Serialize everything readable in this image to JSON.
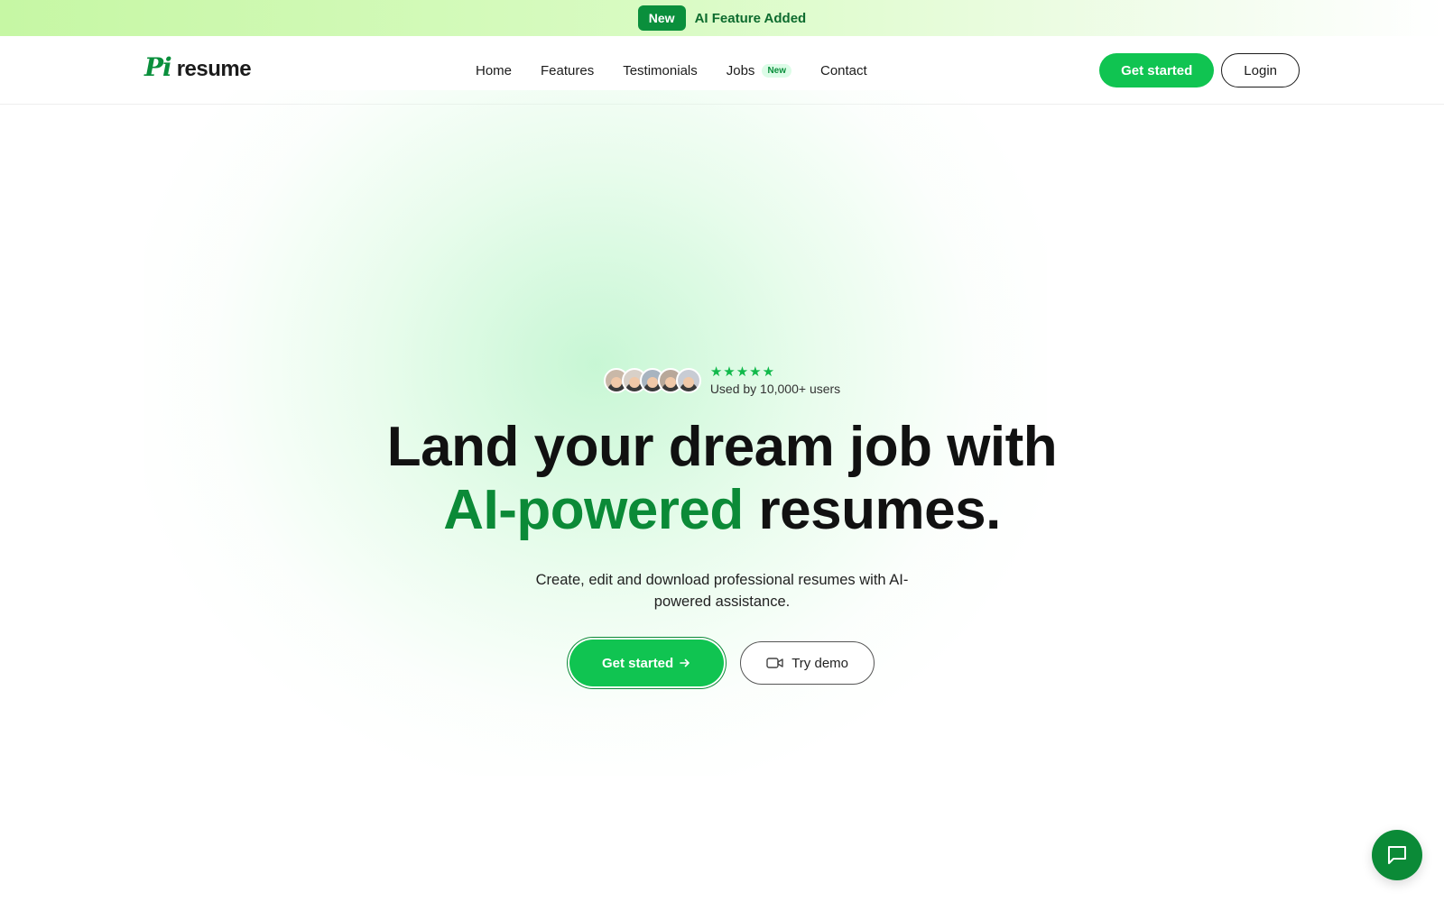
{
  "announcement": {
    "badge": "New",
    "message": "AI Feature Added"
  },
  "brand": {
    "mark": "Pi",
    "name": "resume",
    "accent_color": "#0b8a37",
    "button_color": "#10c451"
  },
  "nav": {
    "items": [
      {
        "label": "Home"
      },
      {
        "label": "Features"
      },
      {
        "label": "Testimonials"
      },
      {
        "label": "Jobs",
        "badge": "New"
      },
      {
        "label": "Contact"
      }
    ],
    "primary_button": "Get started",
    "login_button": "Login"
  },
  "hero": {
    "rating_stars": 5,
    "stars": "★★★★★",
    "users_text": "Used by 10,000+ users",
    "headline_line1": "Land your dream job with",
    "headline_accent": "AI-powered",
    "headline_rest": "resumes.",
    "subtitle": "Create, edit and download professional resumes with AI-powered assistance.",
    "cta_primary": "Get started",
    "cta_primary_icon": "arrow-right-icon",
    "cta_secondary": "Try demo",
    "cta_secondary_icon": "video-camera-icon",
    "avatars": [
      {
        "bg": "#c9b8a8"
      },
      {
        "bg": "#d8d0c8"
      },
      {
        "bg": "#a8b4c0"
      },
      {
        "bg": "#b8a89a"
      },
      {
        "bg": "#c8ccd4"
      }
    ]
  },
  "chat_widget": {
    "icon": "chat-bubble-icon"
  }
}
